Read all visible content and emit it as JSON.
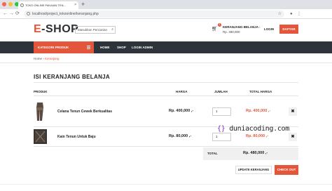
{
  "browser": {
    "tab_title": "TOKO ONLINE PAKAIAN TEN...",
    "tab_close": "×",
    "new_tab": "+",
    "url": "localhost/project_tokoonline/keranjang.php",
    "back": "←",
    "forward": "→",
    "reload": "⟳",
    "star": "☆",
    "window_colors": [
      "#ff5f57",
      "#febc2e",
      "#28c840"
    ]
  },
  "header": {
    "logo_first": "E",
    "logo_rest": "-SHOP",
    "search_placeholder": "Masukkan Pencarian",
    "cart_badge": "1",
    "cart_title": "KERANJANG BELANJA :",
    "cart_total": "Rp. 480,000",
    "login_label": "LOGIN",
    "daftar_label": "DAFTAR"
  },
  "nav": {
    "category_label": "KATEGORI PRODUK",
    "items": [
      "HOME",
      "SHOP",
      "LOGIN ADMIN"
    ]
  },
  "breadcrumb": {
    "home": "Home",
    "sep": "›",
    "current": "Keranjang"
  },
  "cart": {
    "title": "ISI KERANJANG BELANJA",
    "columns": {
      "product": "PRODUK",
      "price": "HARGA",
      "qty": "JUMLAH",
      "total": "TOTAL HARGA"
    },
    "rows": [
      {
        "name": "Celana Tenun Cewek Berkualitas",
        "price": "Rp. 400,000 ,-",
        "qty": "1",
        "total": "Rp. 400,000 ,-",
        "delete": "✖"
      },
      {
        "name": "Kain Tenun Untuk Baju",
        "price": "Rp. 80,000 ,-",
        "qty": "1",
        "total": "Rp. 80,000 ,-",
        "delete": "✖"
      }
    ],
    "sum_label": "TOTAL",
    "sum_value": "Rp. 480,000 ,-",
    "update_label": "UPDATE KERANJANG",
    "checkout_label": "CHECK OUT"
  },
  "watermark": {
    "brace": "{}",
    "text": "duniacoding.com"
  },
  "colors": {
    "accent": "#e4563b",
    "nav_bg": "#2f343b"
  }
}
